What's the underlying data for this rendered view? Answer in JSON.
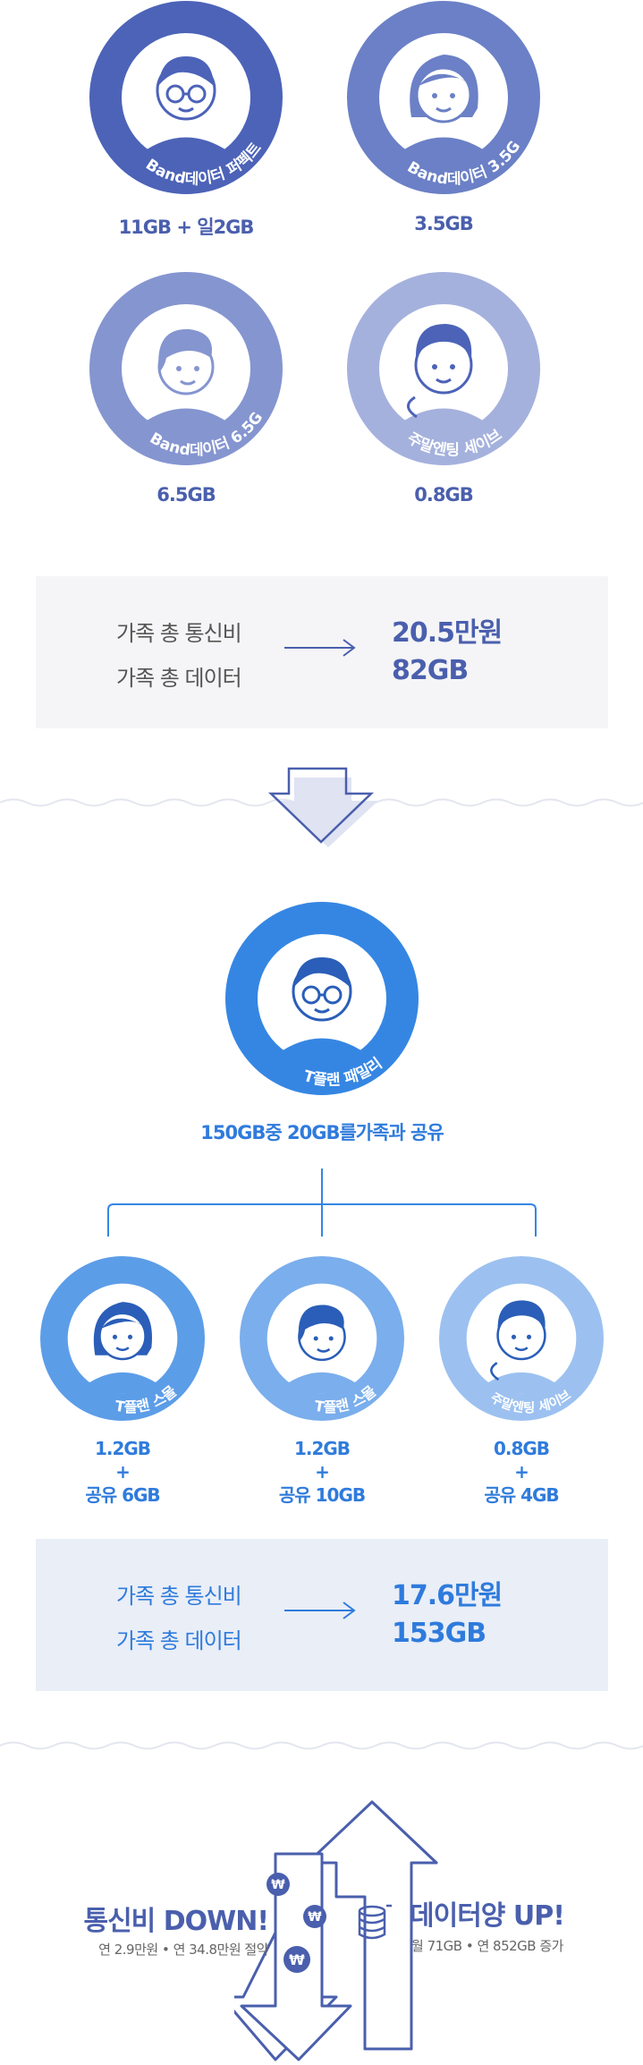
{
  "plan_before": [
    {
      "plan": "Band데이터 퍼펙트",
      "data": "11GB + 일2GB",
      "color": "#4c63b8"
    },
    {
      "plan": "Band데이터 3.5G",
      "data": "3.5GB",
      "color": "#6b80c6"
    },
    {
      "plan": "Band데이터 6.5G",
      "data": "6.5GB",
      "color": "#8595d0"
    },
    {
      "plan": "주말엔팅 세이브",
      "data": "0.8GB",
      "color": "#a5b1dd"
    }
  ],
  "summary_before": {
    "bill_label": "가족 총 통신비",
    "data_label": "가족 총 데이터",
    "bill_value": "20.5만원",
    "data_value": "82GB"
  },
  "plan_after_main": {
    "plan": "T플랜 패밀리",
    "caption": "150GB중 20GB를가족과 공유",
    "color": "#3586e3"
  },
  "plan_after_members": [
    {
      "plan": "T플랜 스몰",
      "data": "1.2GB",
      "plus": "+",
      "share": "공유 6GB",
      "color": "#5c9de8"
    },
    {
      "plan": "T플랜 스몰",
      "data": "1.2GB",
      "plus": "+",
      "share": "공유 10GB",
      "color": "#7aaeec"
    },
    {
      "plan": "주말엔팅 세이브",
      "data": "0.8GB",
      "plus": "+",
      "share": "공유 4GB",
      "color": "#9cc1f0"
    }
  ],
  "summary_after": {
    "bill_label": "가족 총 통신비",
    "data_label": "가족 총 데이터",
    "bill_value": "17.6만원",
    "data_value": "153GB"
  },
  "result": {
    "down_title": "통신비 DOWN!",
    "down_sub": "연 2.9만원 • 연 34.8만원 절약",
    "up_title": "데이터양 UP!",
    "up_sub": "월 71GB • 연 852GB 증가"
  },
  "colors": {
    "dark_text": "#4a5fad",
    "blue_text": "#2f7bdc",
    "summary_bg_before": "#f5f5f7",
    "summary_bg_after": "#e9eef7",
    "arrow_outline": "#4a5fad"
  }
}
